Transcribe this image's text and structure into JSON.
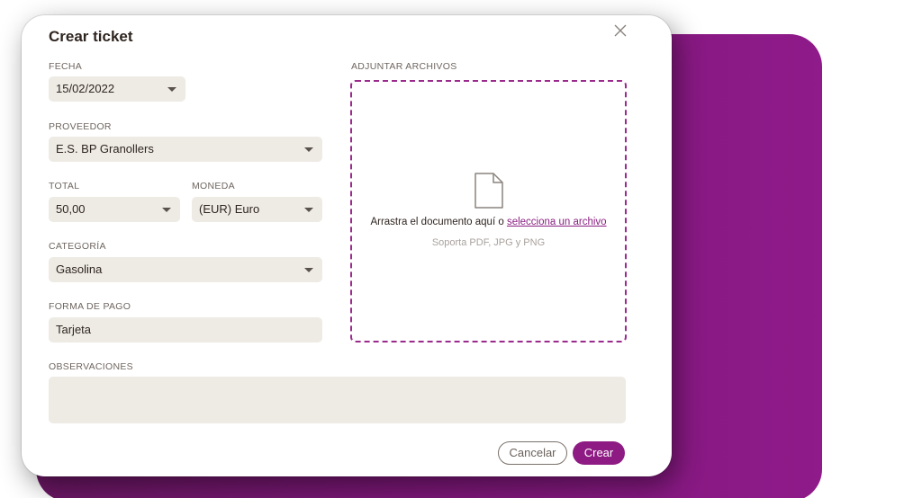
{
  "modal": {
    "title": "Crear ticket"
  },
  "form": {
    "fecha": {
      "label": "FECHA",
      "value": "15/02/2022"
    },
    "proveedor": {
      "label": "PROVEEDOR",
      "value": "E.S. BP Granollers"
    },
    "total": {
      "label": "TOTAL",
      "value": "50,00"
    },
    "moneda": {
      "label": "MONEDA",
      "value": "(EUR) Euro"
    },
    "categoria": {
      "label": "CATEGORÍA",
      "value": "Gasolina"
    },
    "forma_pago": {
      "label": "FORMA DE PAGO",
      "value": "Tarjeta"
    },
    "observaciones": {
      "label": "OBSERVACIONES",
      "value": ""
    }
  },
  "attachments": {
    "label": "ADJUNTAR ARCHIVOS",
    "drop_text": "Arrastra el documento aquí o",
    "link_text": "selecciona un archivo",
    "hint": "Soporta PDF, JPG y PNG"
  },
  "actions": {
    "cancel_label": "Cancelar",
    "create_label": "Crear"
  },
  "colors": {
    "accent": "#8e1a83",
    "background_panel": "#7b1776",
    "field_bg": "#eeebe5"
  }
}
